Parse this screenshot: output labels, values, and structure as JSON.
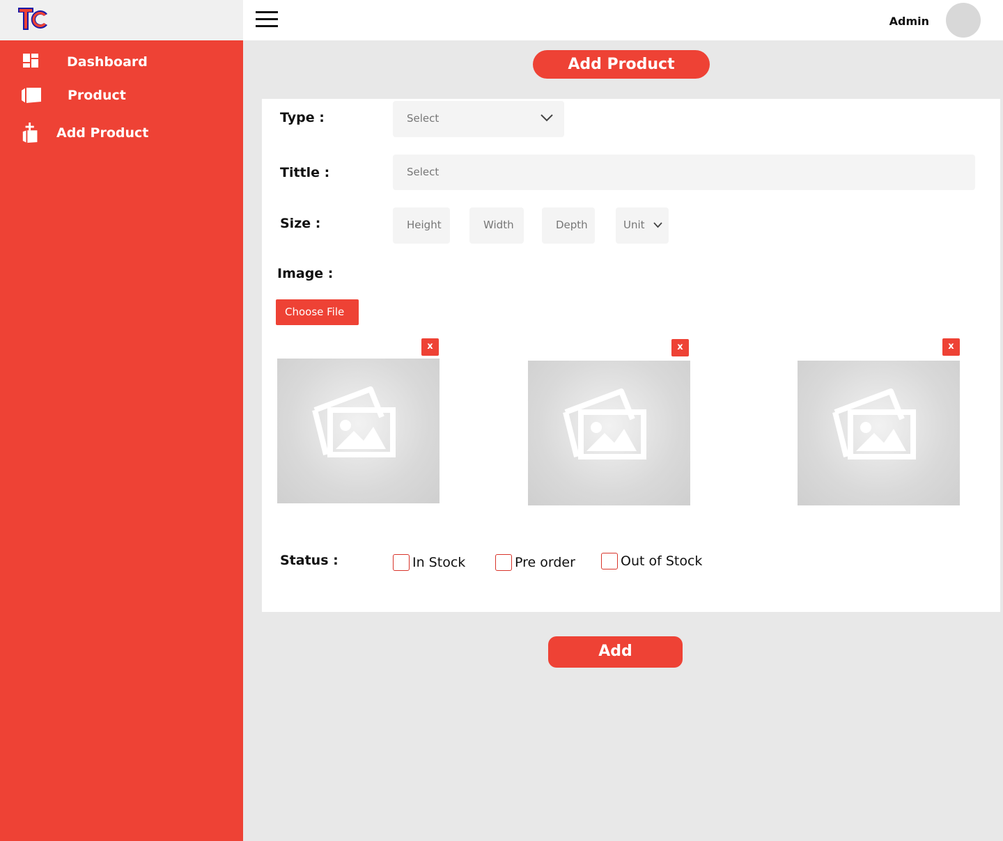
{
  "app": {
    "logo_text": "TC",
    "logo_icon": "tc-logo"
  },
  "sidebar": {
    "items": [
      {
        "label": "Dashboard",
        "icon": "dashboard-icon"
      },
      {
        "label": "Product",
        "icon": "box-icon"
      },
      {
        "label": "Add Product",
        "icon": "add-box-icon"
      }
    ]
  },
  "topbar": {
    "menu_icon": "hamburger-icon",
    "user_name": "Admin"
  },
  "page": {
    "title": "Add Product"
  },
  "form": {
    "type": {
      "label": "Type :",
      "value": "Select"
    },
    "title": {
      "label": "Tittle :",
      "value": "Select"
    },
    "size": {
      "label": "Size :",
      "height": "Height",
      "width": "Width",
      "depth": "Depth",
      "unit": "Unit"
    },
    "image": {
      "label": "Image :",
      "choose_label": "Choose File",
      "remove_label": "x"
    },
    "status": {
      "label": "Status :",
      "options": [
        {
          "label": "In Stock",
          "checked": false
        },
        {
          "label": "Pre order",
          "checked": false
        },
        {
          "label": "Out of Stock",
          "checked": false
        }
      ]
    },
    "submit_label": "Add"
  },
  "colors": {
    "accent": "#ee4235",
    "background": "#e8e8e8",
    "card": "#ffffff"
  }
}
